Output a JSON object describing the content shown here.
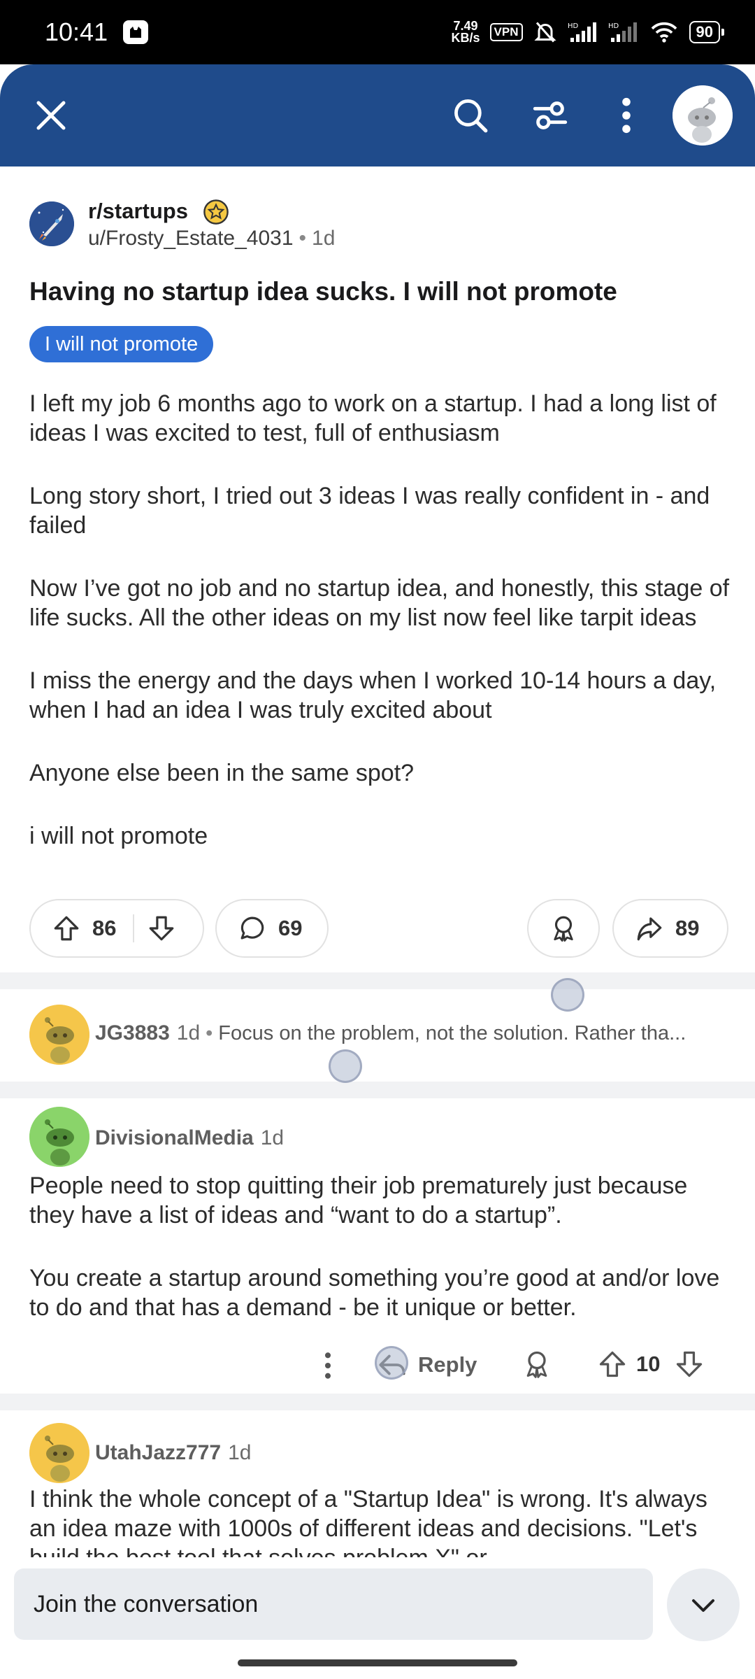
{
  "status_bar": {
    "time": "10:41",
    "net_speed_value": "7.49",
    "net_speed_unit": "KB/s",
    "vpn": "VPN",
    "battery": "90"
  },
  "header": {
    "icons": [
      "close-icon",
      "search-icon",
      "filter-icon",
      "more-vert-icon",
      "avatar"
    ]
  },
  "post": {
    "subreddit": "r/startups",
    "author": "u/Frosty_Estate_4031",
    "separator": "•",
    "time": "1d",
    "title": "Having no startup idea sucks. I will not promote",
    "flair": "I will not promote",
    "body": [
      "I left my job 6 months ago to work on a startup. I had a long list of ideas I was excited to test, full of enthusiasm",
      "Long story short, I tried out 3 ideas I was really confident in - and failed",
      "Now I’ve got no job and no startup idea, and honestly, this stage of life sucks. All the other ideas on my list now feel like tarpit ideas",
      "I miss the energy and the days when I worked 10-14 hours a day, when I had an idea I was truly excited about",
      "Anyone else been in the same spot?",
      "i will not promote"
    ],
    "upvotes": "86",
    "comments": "69",
    "shares": "89"
  },
  "comments": [
    {
      "user": "JG3883",
      "time": "1d",
      "separator": "•",
      "preview": "Focus on the problem, not the solution. Rather tha..."
    },
    {
      "user": "DivisionalMedia",
      "time": "1d",
      "body": [
        "People need to stop quitting their job prematurely just because they have a list of ideas and “want to do a startup”.",
        "You create a startup around something you’re good at and/or love to do and that has a demand - be it unique or better."
      ],
      "reply_label": "Reply",
      "score": "10"
    },
    {
      "user": "UtahJazz777",
      "time": "1d",
      "body": "I think the whole concept of a \"Startup Idea\" is wrong. It's always an idea maze with 1000s of different ideas and decisions. \"Let's build the best tool that solves problem X\" or"
    }
  ],
  "bottom": {
    "join_placeholder": "Join the conversation"
  },
  "colors": {
    "header_bg": "#1f4b8b",
    "flair_bg": "#2f6fd6",
    "divider": "#f1f2f4"
  }
}
